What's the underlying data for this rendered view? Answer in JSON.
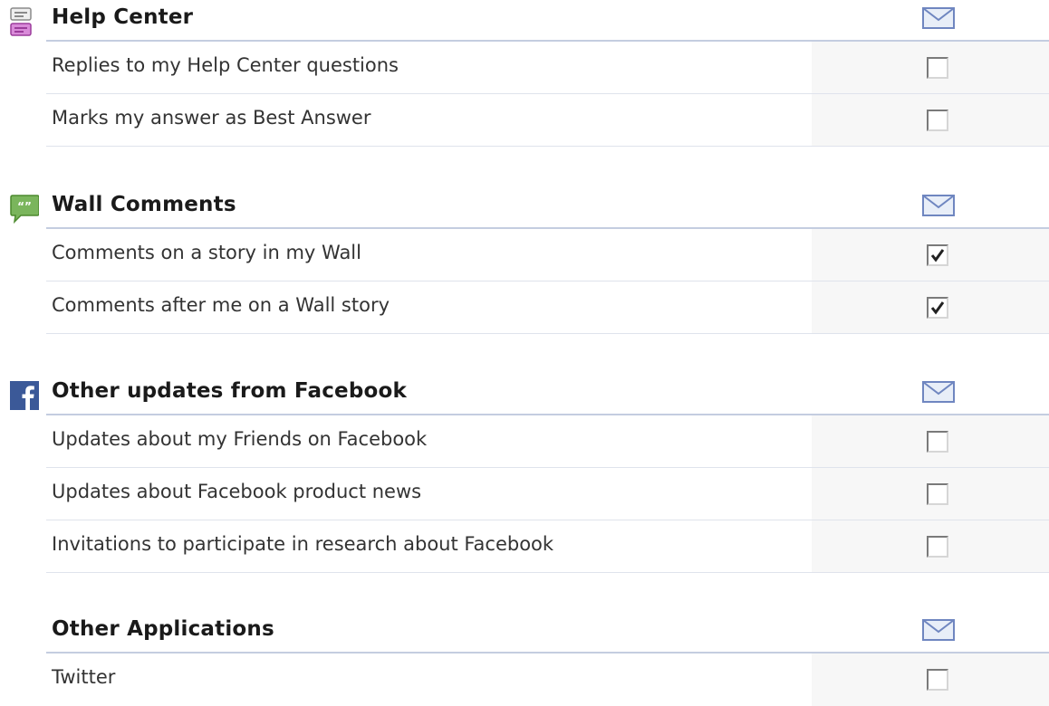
{
  "sections": [
    {
      "title": "Help Center",
      "icon": "help-center-icon",
      "items": [
        {
          "label": "Replies to my Help Center questions",
          "checked": false
        },
        {
          "label": "Marks my answer as Best Answer",
          "checked": false
        }
      ]
    },
    {
      "title": "Wall Comments",
      "icon": "wall-comments-icon",
      "items": [
        {
          "label": "Comments on a story in my Wall",
          "checked": true
        },
        {
          "label": "Comments after me on a Wall story",
          "checked": true
        }
      ]
    },
    {
      "title": "Other updates from Facebook",
      "icon": "facebook-icon",
      "items": [
        {
          "label": "Updates about my Friends on Facebook",
          "checked": false
        },
        {
          "label": "Updates about Facebook product news",
          "checked": false
        },
        {
          "label": "Invitations to participate in research about Facebook",
          "checked": false
        }
      ]
    },
    {
      "title": "Other Applications",
      "icon": "",
      "items": [
        {
          "label": "Twitter",
          "checked": false
        }
      ]
    }
  ],
  "colors": {
    "header_line": "#c4cde0",
    "row_line": "#dfe3ec",
    "checkbox_column_bg": "#f7f7f7",
    "mail_icon": "#6f86c0",
    "facebook_blue": "#3b5998"
  }
}
